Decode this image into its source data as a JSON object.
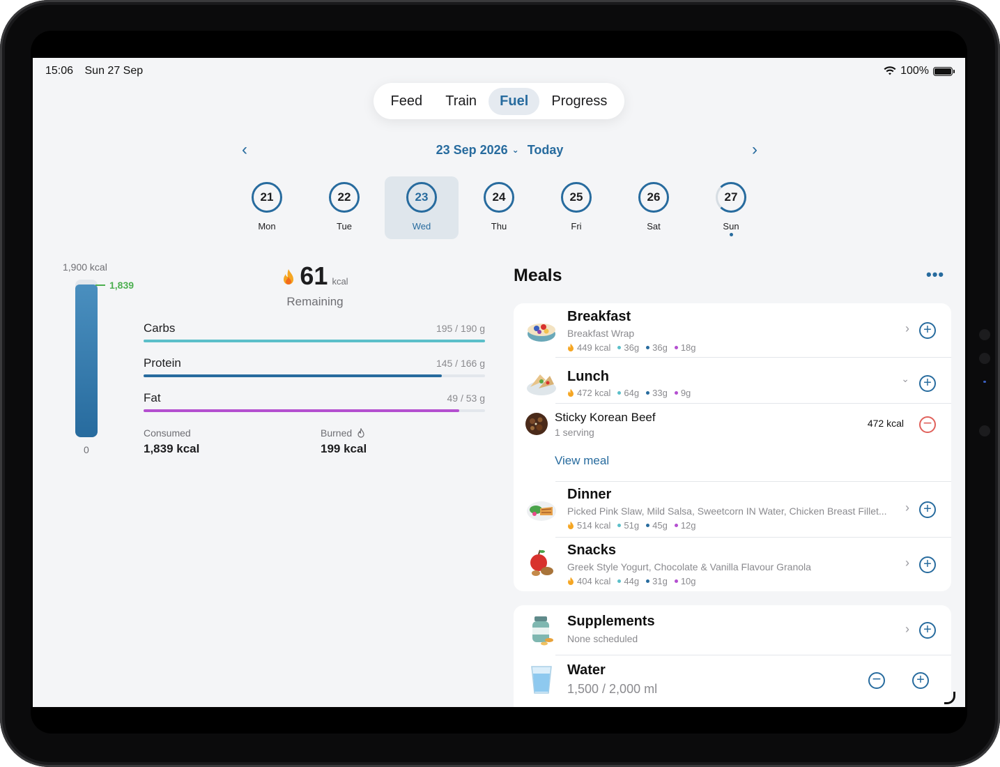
{
  "status": {
    "time": "15:06",
    "date": "Sun 27 Sep",
    "battery": "100%"
  },
  "tabs": [
    {
      "label": "Feed",
      "active": false
    },
    {
      "label": "Train",
      "active": false
    },
    {
      "label": "Fuel",
      "active": true
    },
    {
      "label": "Progress",
      "active": false
    }
  ],
  "date_nav": {
    "date": "23 Sep 2026",
    "today_label": "Today"
  },
  "days": [
    {
      "num": "21",
      "name": "Mon",
      "selected": false
    },
    {
      "num": "22",
      "name": "Tue",
      "selected": false
    },
    {
      "num": "23",
      "name": "Wed",
      "selected": true
    },
    {
      "num": "24",
      "name": "Thu",
      "selected": false
    },
    {
      "num": "25",
      "name": "Fri",
      "selected": false
    },
    {
      "num": "26",
      "name": "Sat",
      "selected": false
    },
    {
      "num": "27",
      "name": "Sun",
      "selected": false,
      "dot": true
    }
  ],
  "summary": {
    "goal_label": "1,900 kcal",
    "consumed_marker": "1,839",
    "zero_label": "0",
    "bar_fraction": 0.968,
    "remaining_value": "61",
    "remaining_unit": "kcal",
    "remaining_label": "Remaining",
    "consumed_label": "Consumed",
    "consumed_value": "1,839 kcal",
    "burned_label": "Burned",
    "burned_value": "199 kcal"
  },
  "macros": [
    {
      "name": "Carbs",
      "value": "195 / 190 g",
      "fraction": 1.0,
      "color": "#5bbfc9"
    },
    {
      "name": "Protein",
      "value": "145 / 166 g",
      "fraction": 0.873,
      "color": "#276b9e"
    },
    {
      "name": "Fat",
      "value": "49 / 53 g",
      "fraction": 0.925,
      "color": "#b44fd0"
    }
  ],
  "colors": {
    "accent": "#276b9e",
    "carbs": "#5bbfc9",
    "protein": "#276b9e",
    "fat": "#b44fd0",
    "consumed": "#4caf50",
    "remove": "#e0605a"
  },
  "meals": {
    "title": "Meals",
    "more_label": "•••",
    "breakfast": {
      "title": "Breakfast",
      "desc": "Breakfast Wrap",
      "kcal": "449 kcal",
      "carbs": "36g",
      "protein": "36g",
      "fat": "18g"
    },
    "lunch": {
      "title": "Lunch",
      "kcal": "472 kcal",
      "carbs": "64g",
      "protein": "33g",
      "fat": "9g",
      "item": {
        "title": "Sticky Korean Beef",
        "sub": "1 serving",
        "kcal": "472 kcal"
      },
      "view_meal": "View meal"
    },
    "dinner": {
      "title": "Dinner",
      "desc": "Picked Pink Slaw, Mild Salsa, Sweetcorn IN Water, Chicken Breast Fillet...",
      "kcal": "514 kcal",
      "carbs": "51g",
      "protein": "45g",
      "fat": "12g"
    },
    "snacks": {
      "title": "Snacks",
      "desc": "Greek Style Yogurt, Chocolate & Vanilla Flavour Granola",
      "kcal": "404 kcal",
      "carbs": "44g",
      "protein": "31g",
      "fat": "10g"
    }
  },
  "supplements": {
    "title": "Supplements",
    "desc": "None scheduled"
  },
  "water": {
    "title": "Water",
    "amount": "1,500 / 2,000 ml"
  }
}
